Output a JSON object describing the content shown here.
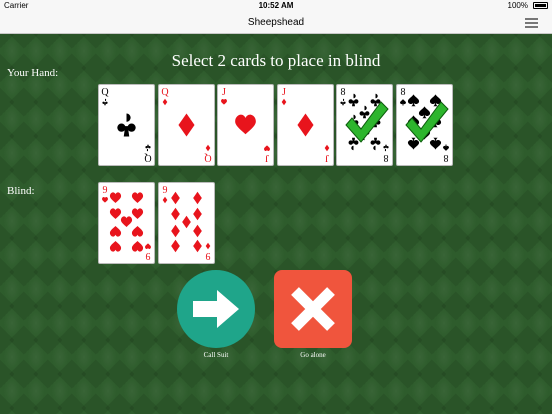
{
  "status_bar": {
    "carrier": "Carrier",
    "time": "10:52 AM",
    "battery": "100%"
  },
  "nav": {
    "title": "Sheepshead",
    "menu_icon": "hamburger-menu-icon"
  },
  "instruction": "Select 2 cards to place in blind",
  "hand": {
    "label": "Your Hand:",
    "cards": [
      {
        "rank": "Q",
        "suit": "clubs",
        "selected": false
      },
      {
        "rank": "Q",
        "suit": "diamonds",
        "selected": false
      },
      {
        "rank": "J",
        "suit": "hearts",
        "selected": false
      },
      {
        "rank": "J",
        "suit": "diamonds",
        "selected": false
      },
      {
        "rank": "8",
        "suit": "clubs",
        "selected": true
      },
      {
        "rank": "8",
        "suit": "spades",
        "selected": true
      }
    ]
  },
  "blind": {
    "label": "Blind:",
    "cards": [
      {
        "rank": "9",
        "suit": "hearts",
        "selected": false
      },
      {
        "rank": "9",
        "suit": "diamonds",
        "selected": false
      }
    ]
  },
  "actions": {
    "call_suit": {
      "label": "Call Suit",
      "icon": "arrow-right-icon",
      "color": "#1fa58a"
    },
    "go_alone": {
      "label": "Go alone",
      "icon": "close-x-icon",
      "color": "#f0553d"
    }
  },
  "colors": {
    "table": "#2e5c2c",
    "red_suit": "#e8141c",
    "black_suit": "#000000",
    "check": "#2db52d"
  }
}
